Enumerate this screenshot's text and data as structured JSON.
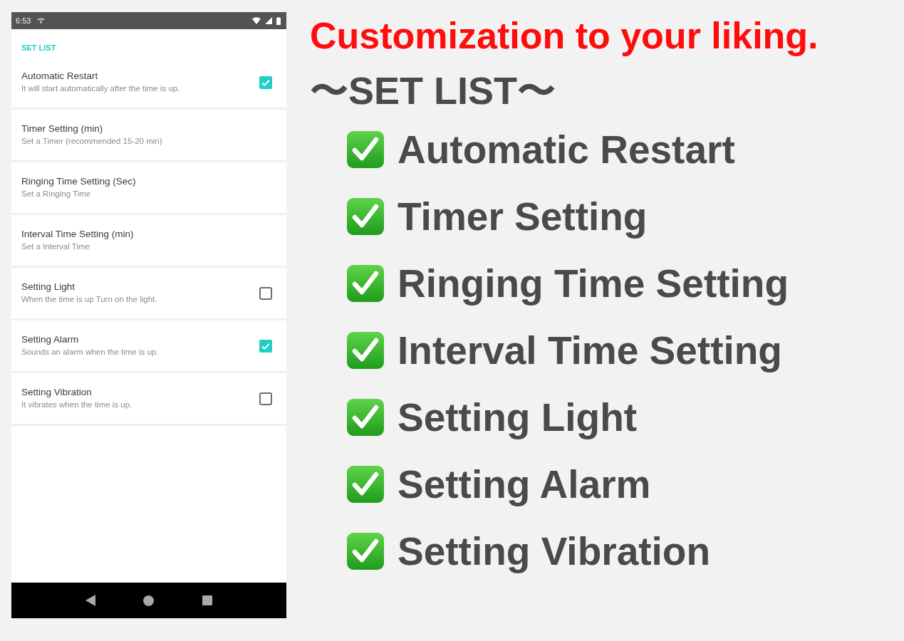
{
  "phone": {
    "status_bar": {
      "time": "6:53"
    },
    "section_title": "SET LIST",
    "settings": [
      {
        "title": "Automatic Restart",
        "summary": "It will start automatically after the time is up.",
        "kind": "checkbox",
        "checked": true
      },
      {
        "title": "Timer Setting (min)",
        "summary": "Set a Timer (recommended 15-20 min)",
        "kind": "plain"
      },
      {
        "title": "Ringing Time Setting (Sec)",
        "summary": "Set a Ringing Time",
        "kind": "plain"
      },
      {
        "title": "Interval Time Setting (min)",
        "summary": "Set a Interval Time",
        "kind": "plain"
      },
      {
        "title": "Setting Light",
        "summary": "When the time is up Turn on the light.",
        "kind": "checkbox",
        "checked": false
      },
      {
        "title": "Setting Alarm",
        "summary": "Sounds an alarm when the time is up.",
        "kind": "checkbox",
        "checked": true
      },
      {
        "title": "Setting Vibration",
        "summary": "It vibrates when the time is up.",
        "kind": "checkbox",
        "checked": false
      }
    ]
  },
  "promo": {
    "headline": "Customization to your liking.",
    "subheading": "〜SET LIST〜",
    "features": [
      "Automatic Restart",
      "Timer Setting",
      "Ringing Time Setting",
      "Interval Time Setting",
      "Setting Light",
      "Setting Alarm",
      "Setting Vibration"
    ]
  }
}
